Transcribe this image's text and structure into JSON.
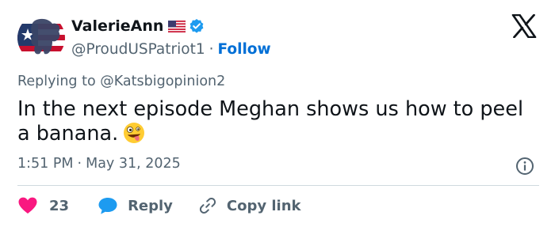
{
  "header": {
    "display_name": "ValerieAnn",
    "handle": "@ProudUSPatriot1",
    "separator": "·",
    "follow_label": "Follow",
    "flag_icon": "us-flag-icon",
    "verified_icon": "verified-badge-icon",
    "logo_icon": "x-logo-icon"
  },
  "tweet": {
    "replying_prefix": "Replying to",
    "replying_to": "@Katsbigopinion2",
    "text": "In the next episode Meghan shows us how to peel a banana.",
    "emoji_icon": "zany-face-emoji-icon",
    "time": "1:51 PM",
    "separator": "·",
    "date": "May 31, 2025",
    "info_icon": "info-icon"
  },
  "actions": {
    "like_count": "23",
    "reply_label": "Reply",
    "copy_link_label": "Copy link"
  },
  "colors": {
    "text": "#0f1419",
    "muted": "#536471",
    "link": "#006fd6",
    "verified": "#1d9bf0",
    "like": "#f91880",
    "reply_bubble": "#1d9bf0",
    "divider": "#cfd9de"
  }
}
